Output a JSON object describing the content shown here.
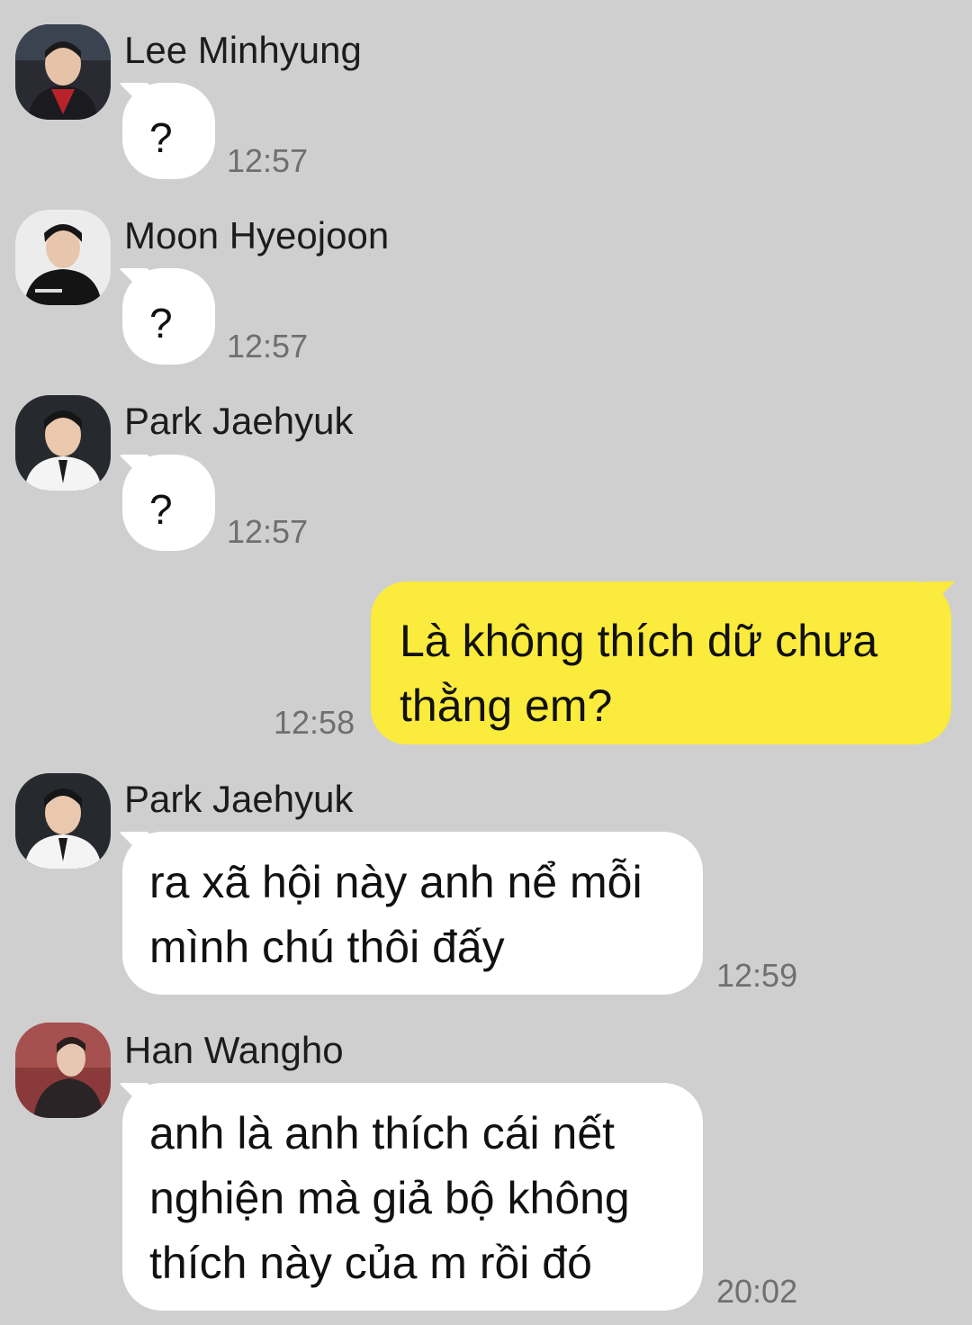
{
  "colors": {
    "background": "#cfcfcf",
    "incoming_bubble": "#ffffff",
    "outgoing_bubble": "#fbeb3c",
    "timestamp": "#6f6f6f"
  },
  "messages": [
    {
      "sender": "Lee Minhyung",
      "avatar": "avatar-photo",
      "text": "?",
      "time": "12:57"
    },
    {
      "sender": "Moon Hyeojoon",
      "avatar": "avatar-photo",
      "text": "?",
      "time": "12:57"
    },
    {
      "sender": "Park Jaehyuk",
      "avatar": "avatar-photo",
      "text": "?",
      "time": "12:57"
    },
    {
      "sender": "",
      "outgoing": true,
      "lines": [
        "Là không thích dữ chưa",
        "thằng em?"
      ],
      "time": "12:58"
    },
    {
      "sender": "Park Jaehyuk",
      "avatar": "avatar-photo",
      "lines": [
        "ra xã hội này anh nể mỗi",
        "mình chú thôi đấy"
      ],
      "time": "12:59"
    },
    {
      "sender": "Han Wangho",
      "avatar": "avatar-photo",
      "lines": [
        "anh là anh thích cái nết",
        "nghiện mà giả bộ không",
        "thích này của m rồi đó"
      ],
      "time": "20:02"
    }
  ]
}
